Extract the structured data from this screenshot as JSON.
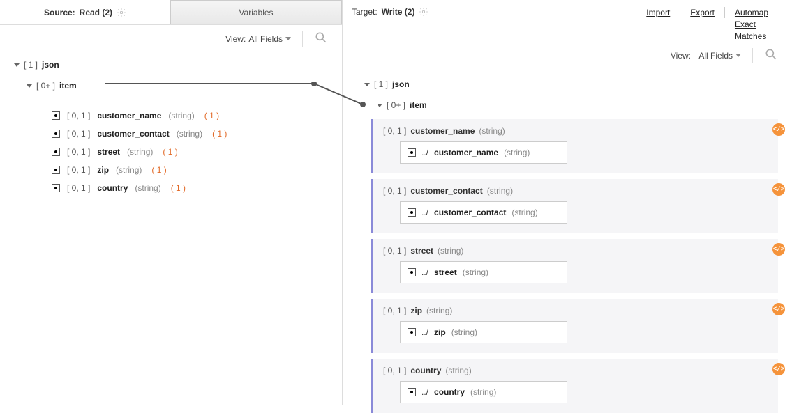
{
  "source": {
    "title_label": "Source:",
    "title_value": "Read (2)",
    "tab_variables": "Variables",
    "view_label": "View:",
    "view_value": "All Fields",
    "root_occ": "[ 1 ]",
    "root_name": "json",
    "item_occ": "[ 0+ ]",
    "item_name": "item",
    "field_occ": "[ 0, 1 ]",
    "fields": [
      {
        "name": "customer_name",
        "type": "(string)",
        "count": "( 1 )"
      },
      {
        "name": "customer_contact",
        "type": "(string)",
        "count": "( 1 )"
      },
      {
        "name": "street",
        "type": "(string)",
        "count": "( 1 )"
      },
      {
        "name": "zip",
        "type": "(string)",
        "count": "( 1 )"
      },
      {
        "name": "country",
        "type": "(string)",
        "count": "( 1 )"
      }
    ]
  },
  "target": {
    "title_label": "Target:",
    "title_value": "Write (2)",
    "link_import": "Import",
    "link_export": "Export",
    "link_automap_l1": "Automap",
    "link_automap_l2": "Exact",
    "link_automap_l3": "Matches",
    "view_label": "View:",
    "view_value": "All Fields",
    "root_occ": "[ 1 ]",
    "root_name": "json",
    "item_occ": "[ 0+ ]",
    "item_name": "item",
    "field_occ": "[ 0, 1 ]",
    "path_prefix": "../",
    "boxes": [
      {
        "name": "customer_name",
        "type": "(string)"
      },
      {
        "name": "customer_contact",
        "type": "(string)"
      },
      {
        "name": "street",
        "type": "(string)"
      },
      {
        "name": "zip",
        "type": "(string)"
      },
      {
        "name": "country",
        "type": "(string)"
      }
    ],
    "code_badge": "</>"
  }
}
